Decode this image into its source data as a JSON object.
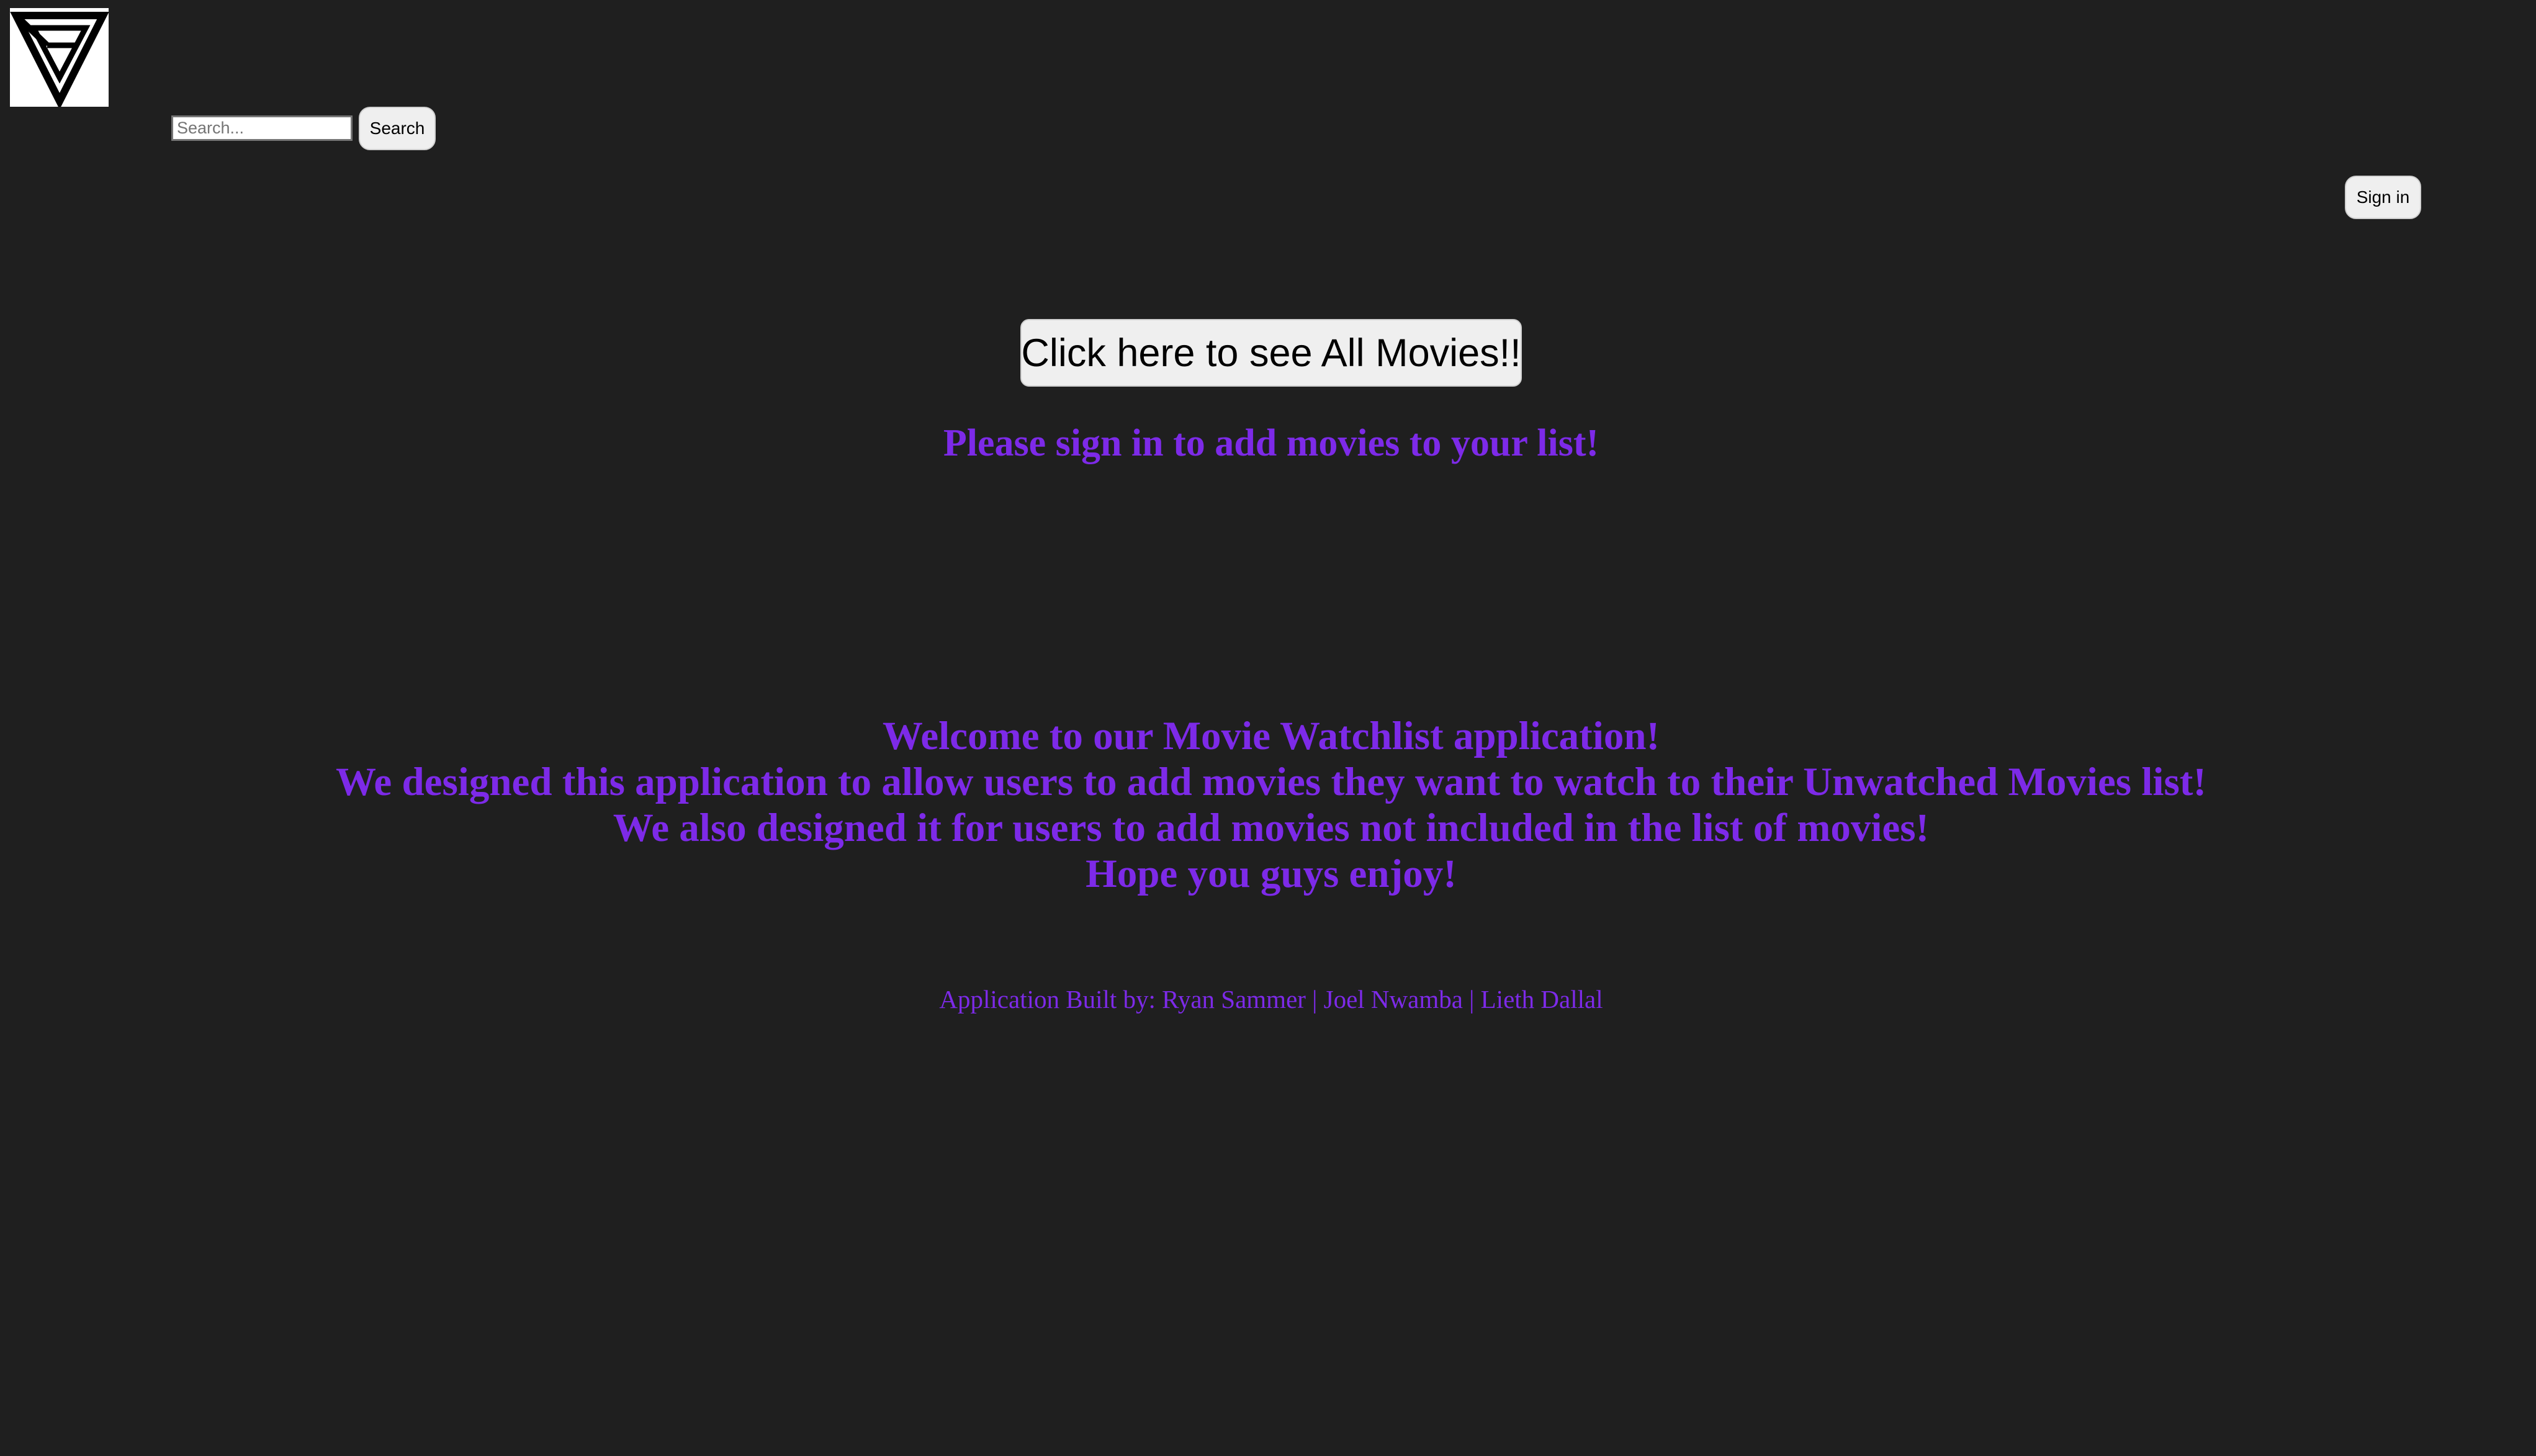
{
  "header": {
    "logo_icon": "triangle-monogram-logo-icon",
    "search": {
      "placeholder": "Search...",
      "value": "",
      "button_label": "Search"
    },
    "signin_label": "Sign in"
  },
  "main": {
    "all_movies_button_label": "Click here to see All Movies!!",
    "signin_prompt": "Please sign in to add movies to your list!",
    "welcome_lines": [
      "Welcome to our Movie Watchlist application!",
      "We designed this application to allow users to add movies they want to watch to their Unwatched Movies list!",
      "We also designed it for users to add movies not included in the list of movies!",
      "Hope you guys enjoy!"
    ],
    "credits": "Application Built by: Ryan Sammer | Joel Nwamba | Lieth Dallal"
  },
  "colors": {
    "background": "#1f1f1f",
    "accent_purple": "#7d2ae8",
    "button_bg": "#efefef"
  }
}
